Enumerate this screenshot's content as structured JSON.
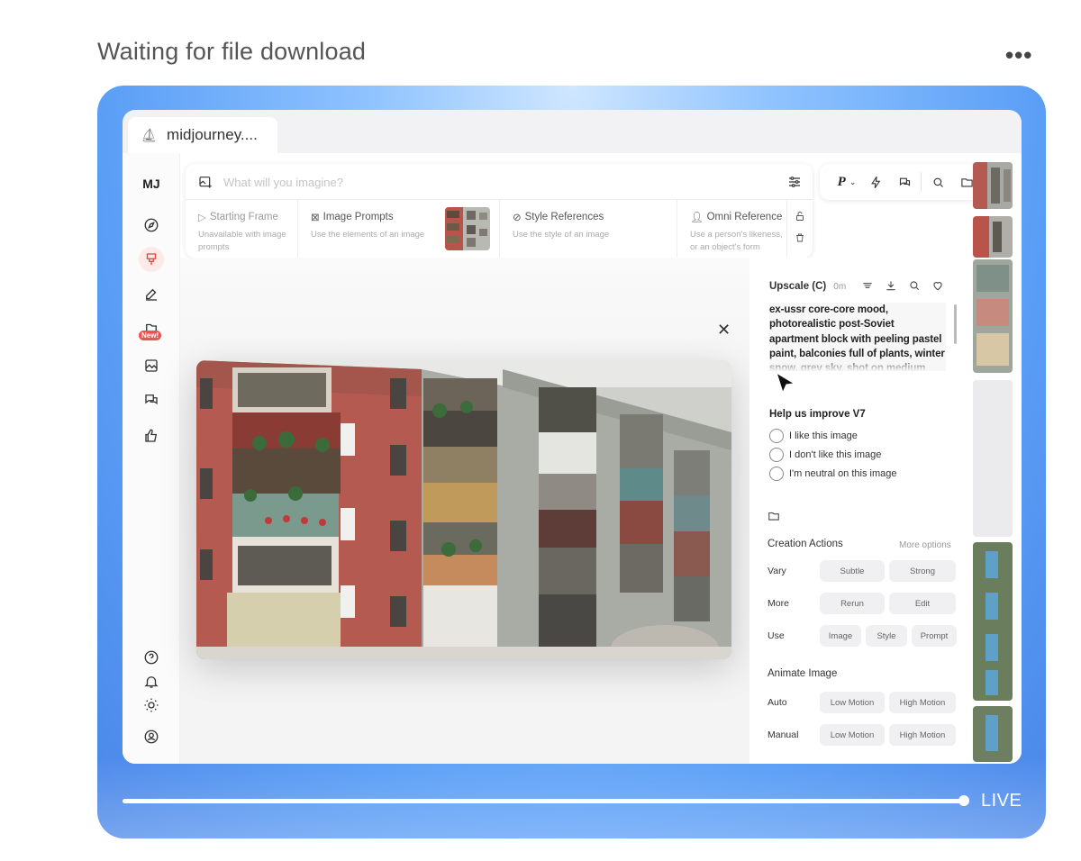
{
  "header": {
    "title": "Waiting for file download",
    "menu_icon": "more-horizontal-icon"
  },
  "browser": {
    "tab_title": "midjourney...."
  },
  "rail": {
    "logo": "MJ",
    "new_badge": "New!"
  },
  "prompt_bar": {
    "placeholder": "What will you imagine?",
    "refs": [
      {
        "title": "Starting Frame",
        "subtitle": "Unavailable with image prompts"
      },
      {
        "title": "Image Prompts",
        "subtitle": "Use the elements of an image"
      },
      {
        "title": "Style References",
        "subtitle": "Use the style of an image"
      },
      {
        "title": "Omni Reference",
        "subtitle": "Use a person's likeness, or an object's form"
      }
    ]
  },
  "toolbar": {
    "personalize_label": "P"
  },
  "panel": {
    "title": "Upscale (C)",
    "time": "0m",
    "prompt_text": "ex-ussr core-core mood, photorealistic post-Soviet apartment block with peeling pastel paint, balconies full of plants, winter snow, grey sky, shot on medium format film",
    "help_title": "Help us improve V7",
    "feedback": [
      "I like this image",
      "I don't like this image",
      "I'm neutral on this image"
    ],
    "creation_title": "Creation Actions",
    "more_options": "More options",
    "rows": {
      "vary": {
        "label": "Vary",
        "buttons": [
          "Subtle",
          "Strong"
        ]
      },
      "more": {
        "label": "More",
        "buttons": [
          "Rerun",
          "Edit"
        ]
      },
      "use": {
        "label": "Use",
        "buttons": [
          "Image",
          "Style",
          "Prompt"
        ]
      }
    },
    "animate_title": "Animate Image",
    "animate": {
      "auto": {
        "label": "Auto",
        "buttons": [
          "Low Motion",
          "High Motion"
        ]
      },
      "manual": {
        "label": "Manual",
        "buttons": [
          "Low Motion",
          "High Motion"
        ]
      }
    }
  },
  "playback": {
    "live_label": "LIVE",
    "progress": 1.0
  },
  "colors": {
    "accent": "#e0473e",
    "stage": "#5a9ef6"
  }
}
